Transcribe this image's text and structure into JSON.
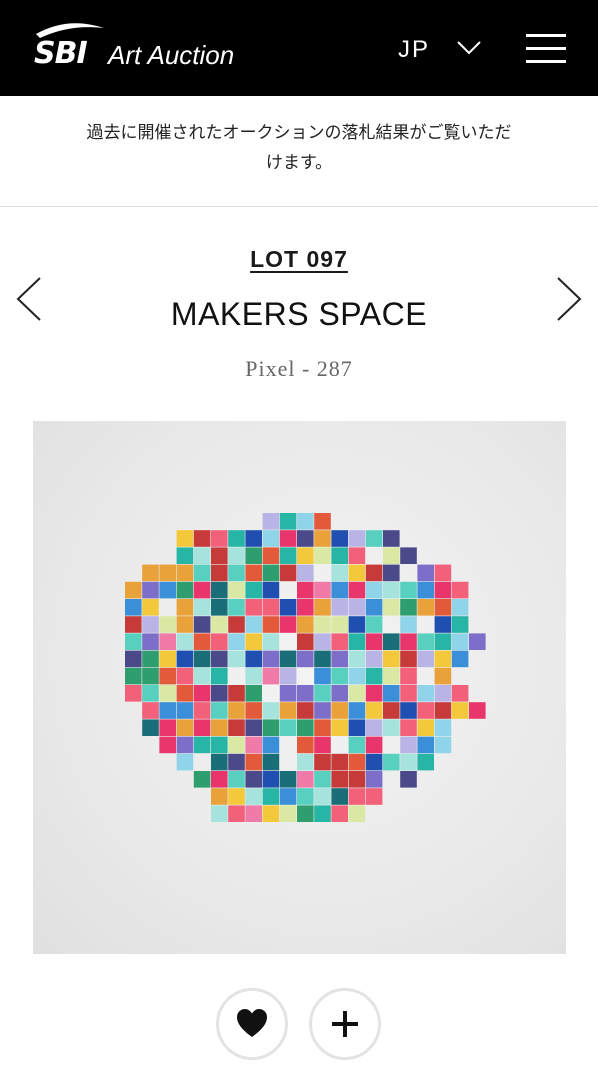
{
  "header": {
    "logo_mark": "SBI",
    "logo_text": "Art Auction",
    "language": "JP",
    "language_icon": "chevron-down-icon",
    "menu_icon": "hamburger-menu-icon"
  },
  "notice": {
    "line1": "過去に開催されたオークションの落札結果がご覧いただ",
    "line2": "けます。"
  },
  "lot": {
    "number_label": "LOT 097",
    "artist": "MAKERS SPACE",
    "work_title": "Pixel - 287",
    "prev_icon": "chevron-left-icon",
    "next_icon": "chevron-right-icon"
  },
  "artwork": {
    "description_icon": "artwork-image",
    "palette": [
      "#e8356b",
      "#f2607a",
      "#3a8fd8",
      "#1f4fb0",
      "#27b5a5",
      "#58d0c0",
      "#a6e3dc",
      "#f3c83a",
      "#e9a23a",
      "#8fd4e8",
      "#b9b4e6",
      "#7d6fc9",
      "#d9e9a3",
      "#1a6e78",
      "#c73a3a",
      "#f07aa8",
      "#e25a3a",
      "#2e9e6e",
      "#4a4a8a"
    ]
  },
  "actions": {
    "favorite_icon": "heart-icon",
    "add_icon": "plus-icon"
  },
  "colors": {
    "header_bg": "#000000",
    "text": "#1a1a1a",
    "subtext": "#666666",
    "divider": "#dddddd"
  }
}
